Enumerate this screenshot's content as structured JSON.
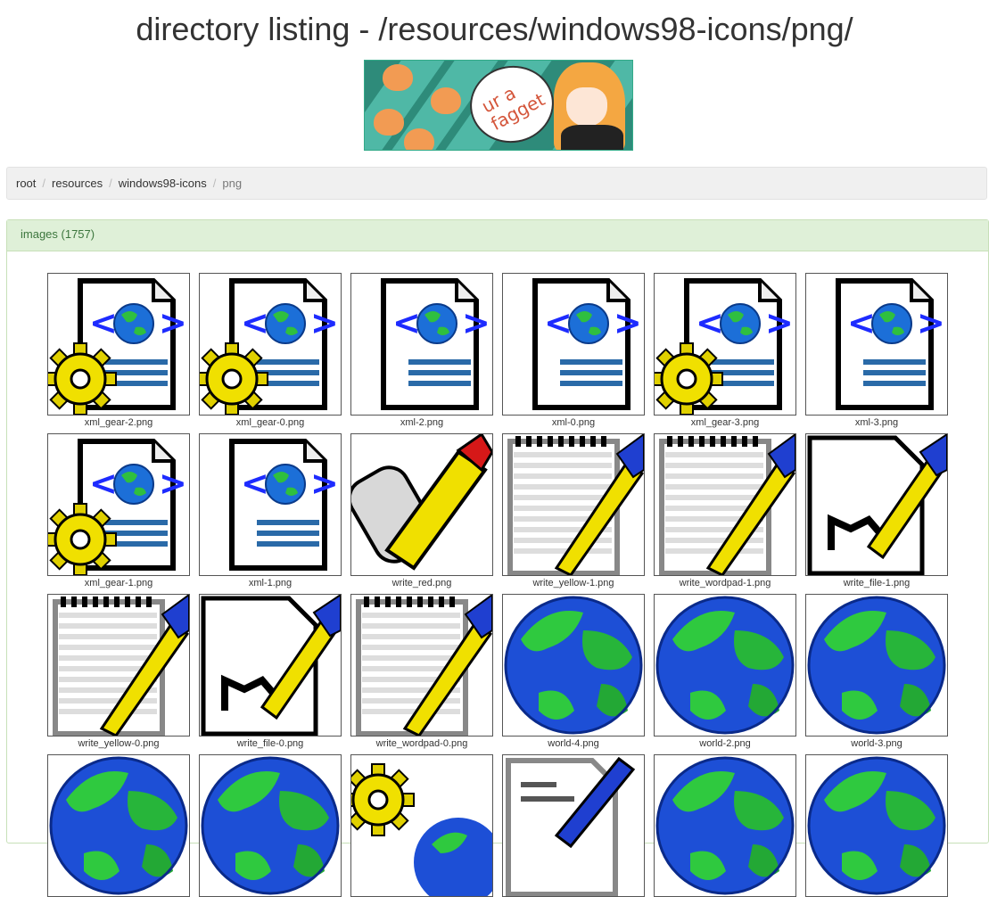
{
  "page": {
    "title": "directory listing - /resources/windows98-icons/png/"
  },
  "banner": {
    "bubble_text": "ur a fagget"
  },
  "breadcrumb": {
    "items": [
      "root",
      "resources",
      "windows98-icons",
      "png"
    ]
  },
  "panel": {
    "heading": "images (1757)"
  },
  "images": [
    {
      "name": "xml_gear-2.png",
      "icon": "xml-gear-document-icon"
    },
    {
      "name": "xml_gear-0.png",
      "icon": "xml-gear-document-icon"
    },
    {
      "name": "xml-2.png",
      "icon": "xml-document-icon"
    },
    {
      "name": "xml-0.png",
      "icon": "xml-document-icon"
    },
    {
      "name": "xml_gear-3.png",
      "icon": "xml-gear-document-icon"
    },
    {
      "name": "xml-3.png",
      "icon": "xml-document-icon"
    },
    {
      "name": "xml_gear-1.png",
      "icon": "xml-gear-document-icon"
    },
    {
      "name": "xml-1.png",
      "icon": "xml-document-icon"
    },
    {
      "name": "write_red.png",
      "icon": "write-scroll-icon"
    },
    {
      "name": "write_yellow-1.png",
      "icon": "notepad-pen-icon"
    },
    {
      "name": "write_wordpad-1.png",
      "icon": "notepad-pen-icon"
    },
    {
      "name": "write_file-1.png",
      "icon": "file-pen-icon"
    },
    {
      "name": "write_yellow-0.png",
      "icon": "notepad-pen-icon"
    },
    {
      "name": "write_file-0.png",
      "icon": "file-pen-icon"
    },
    {
      "name": "write_wordpad-0.png",
      "icon": "notepad-pen-icon"
    },
    {
      "name": "world-4.png",
      "icon": "globe-icon"
    },
    {
      "name": "world-2.png",
      "icon": "globe-icon"
    },
    {
      "name": "world-3.png",
      "icon": "globe-icon"
    },
    {
      "name": "",
      "icon": "globe-icon"
    },
    {
      "name": "",
      "icon": "globe-icon"
    },
    {
      "name": "",
      "icon": "globe-gear-icon"
    },
    {
      "name": "",
      "icon": "document-pen-icon"
    },
    {
      "name": "",
      "icon": "globe-icon"
    },
    {
      "name": "",
      "icon": "globe-icon"
    }
  ]
}
